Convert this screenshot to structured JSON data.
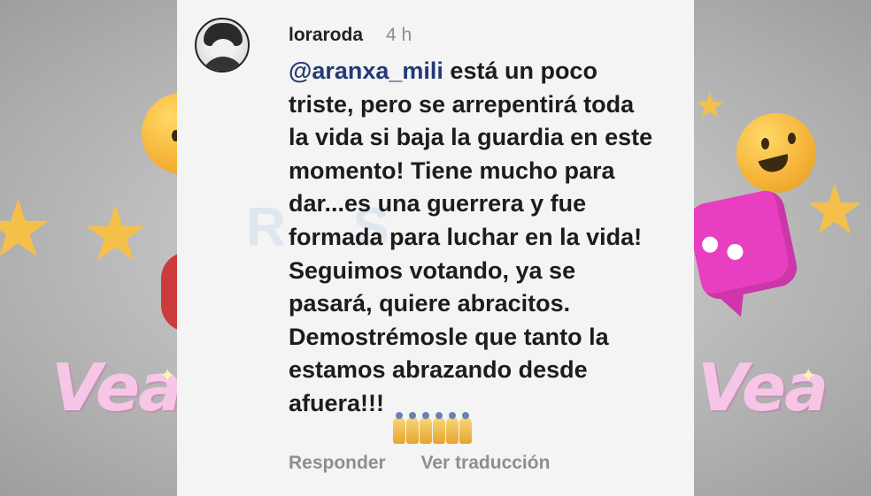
{
  "comment": {
    "username": "loraroda",
    "time": "4 h",
    "mention": "@aranxa_mili",
    "text": " está  un poco\ntriste, pero se arrepentirá  toda\nla vida si baja la guardia en este\nmomento! Tiene mucho para\ndar...es una guerrera y fue\nformada para luchar en la vida!\nSeguimos votando, ya se\npasará, quiere abracitos.\nDemostrémosle que tanto la\nestamos abrazando desde\nafuera!!!",
    "emoji_name": "folded-hands-emoji",
    "emoji_count": 6,
    "actions": {
      "reply": "Responder",
      "translate": "Ver traducción"
    }
  },
  "decor": {
    "left_vea": "Vea",
    "right_vea": "Vea",
    "colors": {
      "pink_bubble": "#e83fc0",
      "vea_text": "#f7c6e6",
      "star": "#f5c04a",
      "username": "#222222",
      "muted": "#8e8e8e"
    }
  }
}
